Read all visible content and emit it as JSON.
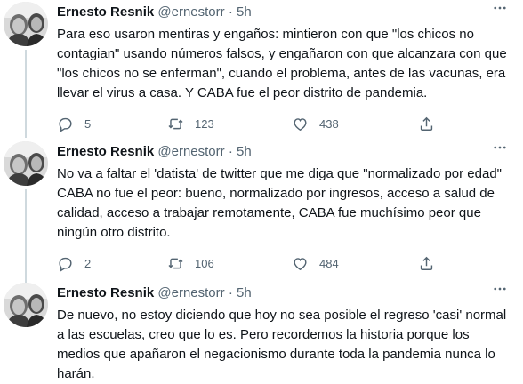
{
  "tweets": [
    {
      "name": "Ernesto Resnik",
      "handle": "@ernestorr",
      "separator": "·",
      "time": "5h",
      "more_icon": "more-horizontal-icon",
      "text": "Para eso usaron mentiras y engaños: mintieron con que \"los chicos no contagian\" usando números falsos, y engañaron con que alcanzara con que \"los chicos no se enferman\", cuando el problema, antes de las vacunas, era llevar el virus a casa. Y CABA fue el peor distrito de pandemia.",
      "replies": "5",
      "retweets": "123",
      "likes": "438"
    },
    {
      "name": "Ernesto Resnik",
      "handle": "@ernestorr",
      "separator": "·",
      "time": "5h",
      "more_icon": "more-horizontal-icon",
      "text": "No va a faltar el 'datista' de twitter que me diga que \"normalizado por edad\" CABA no fue el peor: bueno, normalizado por ingresos, acceso a salud de calidad, acceso a trabajar remotamente, CABA fue muchísimo peor que ningún otro distrito.",
      "replies": "2",
      "retweets": "106",
      "likes": "484"
    },
    {
      "name": "Ernesto Resnik",
      "handle": "@ernestorr",
      "separator": "·",
      "time": "5h",
      "more_icon": "more-horizontal-icon",
      "text": "De nuevo, no estoy diciendo que hoy no sea posible el regreso 'casi' normal a las escuelas, creo que lo es. Pero recordemos la historia porque los medios que apañaron el negacionismo durante toda la pandemia nunca lo harán."
    }
  ]
}
